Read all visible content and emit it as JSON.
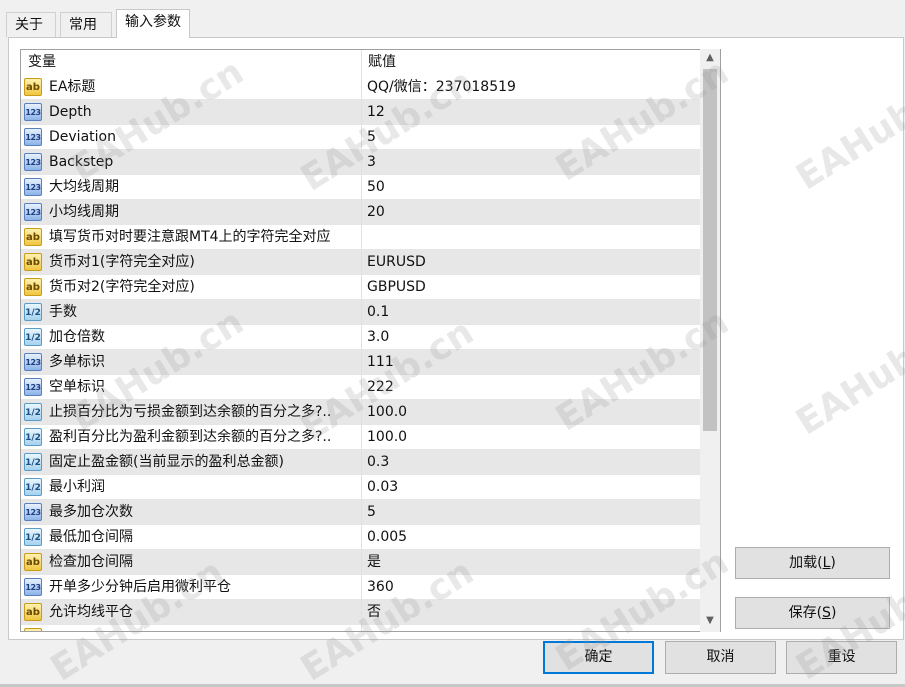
{
  "tabs": [
    "关于",
    "常用",
    "输入参数"
  ],
  "grid": {
    "headers": {
      "variable": "变量",
      "value": "赋值"
    },
    "rows": [
      {
        "type": "ab",
        "name": "EA标题",
        "value": "QQ/微信：237018519"
      },
      {
        "type": "123",
        "name": "Depth",
        "value": "12"
      },
      {
        "type": "123",
        "name": "Deviation",
        "value": "5"
      },
      {
        "type": "123",
        "name": "Backstep",
        "value": "3"
      },
      {
        "type": "123",
        "name": "大均线周期",
        "value": "50"
      },
      {
        "type": "123",
        "name": "小均线周期",
        "value": "20"
      },
      {
        "type": "ab",
        "name": "填写货币对时要注意跟MT4上的字符完全对应",
        "value": ""
      },
      {
        "type": "ab",
        "name": "货币对1(字符完全对应)",
        "value": "EURUSD"
      },
      {
        "type": "ab",
        "name": "货币对2(字符完全对应)",
        "value": "GBPUSD"
      },
      {
        "type": "1/2",
        "name": "手数",
        "value": "0.1"
      },
      {
        "type": "1/2",
        "name": "加仓倍数",
        "value": "3.0"
      },
      {
        "type": "123",
        "name": "多单标识",
        "value": "111"
      },
      {
        "type": "123",
        "name": "空单标识",
        "value": "222"
      },
      {
        "type": "1/2",
        "name": "止损百分比为亏损金额到达余额的百分之多?..",
        "value": "100.0"
      },
      {
        "type": "1/2",
        "name": "盈利百分比为盈利金额到达余额的百分之多?..",
        "value": "100.0"
      },
      {
        "type": "1/2",
        "name": "固定止盈金额(当前显示的盈利总金额)",
        "value": "0.3"
      },
      {
        "type": "1/2",
        "name": "最小利润",
        "value": "0.03"
      },
      {
        "type": "123",
        "name": "最多加仓次数",
        "value": "5"
      },
      {
        "type": "1/2",
        "name": "最低加仓间隔",
        "value": "0.005"
      },
      {
        "type": "ab",
        "name": "检查加仓间隔",
        "value": "是"
      },
      {
        "type": "123",
        "name": "开单多少分钟后启用微利平仓",
        "value": "360"
      },
      {
        "type": "ab",
        "name": "允许均线平仓",
        "value": "否"
      },
      {
        "type": "ab",
        "name": "",
        "value": ""
      }
    ]
  },
  "scrollbar": {
    "up": "▲",
    "down": "▼"
  },
  "buttons": {
    "load": {
      "label": "加载(",
      "key": "L",
      "suffix": ")"
    },
    "save": {
      "label": "保存(",
      "key": "S",
      "suffix": ")"
    },
    "ok": "确定",
    "cancel": "取消",
    "reset": "重设"
  },
  "watermark": "EAHub.cn",
  "watermark_short": "EAHub"
}
